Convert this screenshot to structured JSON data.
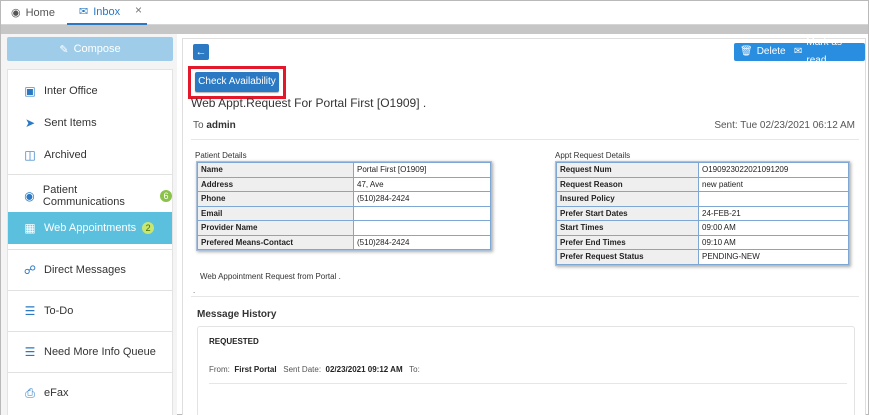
{
  "tabs": {
    "home": {
      "icon": "dashboard-icon",
      "label": "Home"
    },
    "inbox": {
      "icon": "envelope-icon",
      "label": "Inbox",
      "close": "×"
    }
  },
  "sidebar": {
    "compose_label": "Compose",
    "items": [
      {
        "icon": "inbox-icon",
        "label": "Inter Office"
      },
      {
        "icon": "send-icon",
        "label": "Sent Items"
      },
      {
        "icon": "archive-icon",
        "label": "Archived"
      },
      {
        "icon": "chat-icon",
        "label": "Patient Communications",
        "badge": "6"
      },
      {
        "icon": "calendar-icon",
        "label": "Web Appointments",
        "badge": "2",
        "active": true
      },
      {
        "icon": "lock-icon",
        "label": "Direct Messages"
      },
      {
        "icon": "list-icon",
        "label": "To-Do"
      },
      {
        "icon": "list-icon",
        "label": "Need More Info Queue"
      },
      {
        "icon": "fax-icon",
        "label": "eFax"
      }
    ]
  },
  "toolbar": {
    "back_icon": "arrow-left-icon",
    "delete_label": "Delete",
    "mark_label": "Mark as read"
  },
  "message": {
    "check_availability_label": "Check Availability",
    "subject": "Web Appt.Request For Portal First [O1909] .",
    "to_prefix": "To",
    "to_value": "admin",
    "sent": "Sent: Tue 02/23/2021 06:12 AM",
    "body_text": "Web Appointment Request from Portal .",
    "body_dot": "."
  },
  "patient_details": {
    "title": "Patient Details",
    "rows": [
      {
        "k": "Name",
        "v": "Portal First [O1909]"
      },
      {
        "k": "Address",
        "v": "47, Ave"
      },
      {
        "k": "Phone",
        "v": "(510)284-2424"
      },
      {
        "k": "Email",
        "v": ""
      },
      {
        "k": "Provider Name",
        "v": ""
      },
      {
        "k": "Prefered Means-Contact",
        "v": "(510)284-2424"
      }
    ]
  },
  "appt_details": {
    "title": "Appt Request Details",
    "rows": [
      {
        "k": "Request Num",
        "v": "O190923022021091209"
      },
      {
        "k": "Request Reason",
        "v": "new patient"
      },
      {
        "k": "Insured Policy",
        "v": ""
      },
      {
        "k": "Prefer Start Dates",
        "v": "24-FEB-21"
      },
      {
        "k": "Start Times",
        "v": "09:00 AM"
      },
      {
        "k": "Prefer End Times",
        "v": "09:10 AM"
      },
      {
        "k": "Prefer Request Status",
        "v": "PENDING-NEW"
      }
    ]
  },
  "history": {
    "title": "Message History",
    "status": "REQUESTED",
    "from_label": "From:",
    "from_value": "First Portal",
    "sent_label": "Sent Date:",
    "sent_value": "02/23/2021 09:12 AM",
    "to_label": "To:"
  }
}
